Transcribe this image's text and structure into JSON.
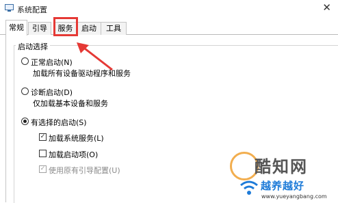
{
  "window": {
    "title": "系统配置",
    "close_glyph": "✕"
  },
  "tabs": [
    {
      "label": "常规",
      "active": true
    },
    {
      "label": "引导",
      "active": false
    },
    {
      "label": "服务",
      "active": false
    },
    {
      "label": "启动",
      "active": false
    },
    {
      "label": "工具",
      "active": false
    }
  ],
  "startup_selection": {
    "title": "启动选择",
    "normal": {
      "label": "正常启动(N)",
      "description": "加载所有设备驱动程序和服务",
      "selected": false
    },
    "diagnostic": {
      "label": "诊断启动(D)",
      "description": "仅加载基本设备和服务",
      "selected": false
    },
    "selective": {
      "label": "有选择的启动(S)",
      "selected": true,
      "options": [
        {
          "label": "加载系统服务(L)",
          "checked": true,
          "enabled": true
        },
        {
          "label": "加载启动项(O)",
          "checked": false,
          "enabled": true
        },
        {
          "label": "使用原有引导配置(U)",
          "checked": true,
          "enabled": false
        }
      ]
    }
  },
  "watermark": {
    "brand": "酷知网",
    "brand2": "越养越好",
    "url": "www.yueyangbang.com"
  },
  "colors": {
    "highlight": "#e53935",
    "accent": "#1e7bd8"
  }
}
